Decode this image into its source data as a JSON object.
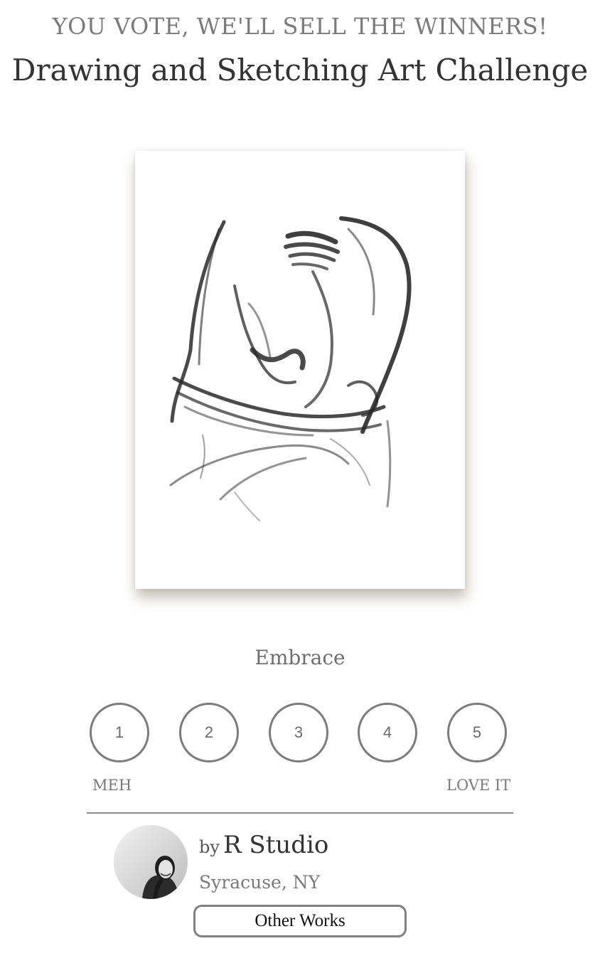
{
  "header": {
    "tagline": "YOU VOTE, WE'LL SELL THE WINNERS!",
    "title": "Drawing and Sketching Art Challenge"
  },
  "artwork": {
    "image": "charcoal-sketch-embracing-figure",
    "title": "Embrace"
  },
  "rating": {
    "options": [
      "1",
      "2",
      "3",
      "4",
      "5"
    ],
    "low_label": "MEH",
    "high_label": "LOVE IT"
  },
  "artist": {
    "by_prefix": "by",
    "name": "R Studio",
    "location": "Syracuse, NY",
    "avatar": "artist-portrait-photo"
  },
  "actions": {
    "other_works_label": "Other Works"
  },
  "colors": {
    "text_dark": "#333333",
    "text_muted": "#7a7a7a",
    "border": "#7c7c7c"
  }
}
